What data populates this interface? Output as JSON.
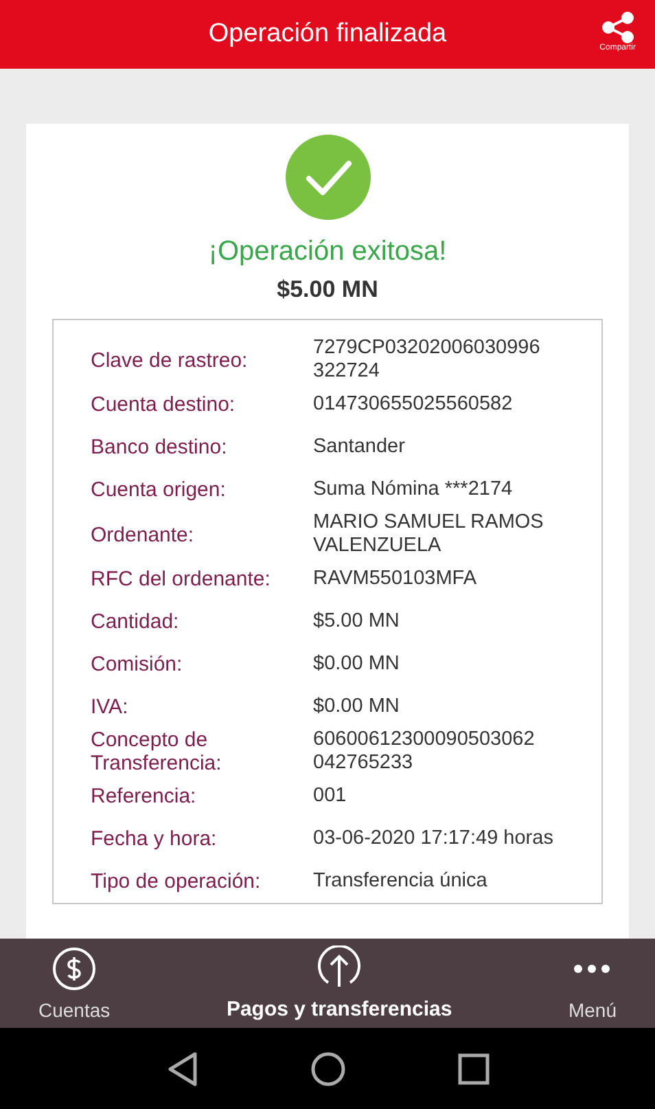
{
  "header": {
    "title": "Operación finalizada",
    "share_label": "Compartir"
  },
  "result": {
    "status": "¡Operación exitosa!",
    "amount": "$5.00 MN"
  },
  "details": [
    {
      "label": "Clave de rastreo:",
      "value": "7279CP03202006030996\n322724"
    },
    {
      "label": "Cuenta destino:",
      "value": "014730655025560582"
    },
    {
      "label": "Banco destino:",
      "value": "Santander"
    },
    {
      "label": "Cuenta origen:",
      "value": "Suma Nómina  ***2174"
    },
    {
      "label": "Ordenante:",
      "value": "MARIO SAMUEL RAMOS\nVALENZUELA"
    },
    {
      "label": "RFC del ordenante:",
      "value": "RAVM550103MFA"
    },
    {
      "label": "Cantidad:",
      "value": "$5.00 MN"
    },
    {
      "label": "Comisión:",
      "value": "$0.00 MN"
    },
    {
      "label": "IVA:",
      "value": "$0.00 MN"
    },
    {
      "label": "Concepto de\nTransferencia:",
      "value": "60600612300090503062\n042765233"
    },
    {
      "label": "Referencia:",
      "value": "001"
    },
    {
      "label": "Fecha y hora:",
      "value": " 03-06-2020 17:17:49 horas"
    },
    {
      "label": "Tipo de operación:",
      "value": "Transferencia única"
    }
  ],
  "bottom_nav": [
    {
      "kind": "dollar",
      "label": "Cuentas",
      "selected": false
    },
    {
      "kind": "upload",
      "label": "Pagos y transferencias",
      "selected": true
    },
    {
      "kind": "more",
      "label": "Menú",
      "selected": false
    }
  ]
}
